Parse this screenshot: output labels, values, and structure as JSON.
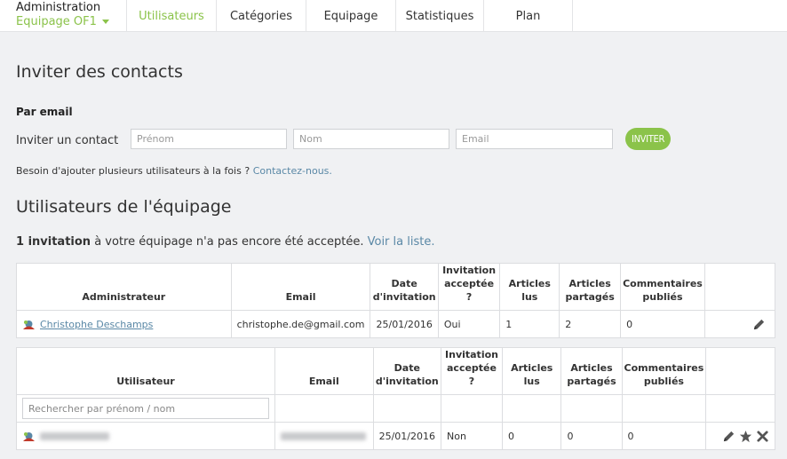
{
  "header": {
    "title": "Administration",
    "crew": "Equipage OF1",
    "tabs": [
      {
        "label": "Utilisateurs",
        "active": true
      },
      {
        "label": "Catégories"
      },
      {
        "label": "Equipage"
      },
      {
        "label": "Statistiques"
      },
      {
        "label": "Plan"
      }
    ]
  },
  "invite": {
    "heading": "Inviter des contacts",
    "by_email": "Par email",
    "contact_label": "Inviter un contact",
    "first_name_ph": "Prénom",
    "last_name_ph": "Nom",
    "email_ph": "Email",
    "button": "INVITER",
    "help_text": "Besoin d'ajouter plusieurs utilisateurs à la fois ?",
    "help_link": "Contactez-nous."
  },
  "users": {
    "heading": "Utilisateurs de l'équipage",
    "pending_bold": "1 invitation",
    "pending_text": "à votre équipage n'a pas encore été acceptée.",
    "pending_link": "Voir la liste."
  },
  "admin_table": {
    "headers": [
      "Administrateur",
      "Email",
      "Date d'invitation",
      "Invitation acceptée ?",
      "Articles lus",
      "Articles partagés",
      "Commentaires publiés"
    ],
    "row": {
      "name": "Christophe Deschamps",
      "email": "christophe.de@gmail.com",
      "date": "25/01/2016",
      "accepted": "Oui",
      "read": "1",
      "shared": "2",
      "comments": "0"
    }
  },
  "user_table": {
    "headers": [
      "Utilisateur",
      "Email",
      "Date d'invitation",
      "Invitation acceptée ?",
      "Articles lus",
      "Articles partagés",
      "Commentaires publiés"
    ],
    "search_ph": "Rechercher par prénom / nom",
    "row": {
      "date": "25/01/2016",
      "accepted": "Non",
      "read": "0",
      "shared": "0",
      "comments": "0"
    }
  },
  "colors": {
    "accent": "#8bc34a",
    "link": "#5a88a6"
  }
}
